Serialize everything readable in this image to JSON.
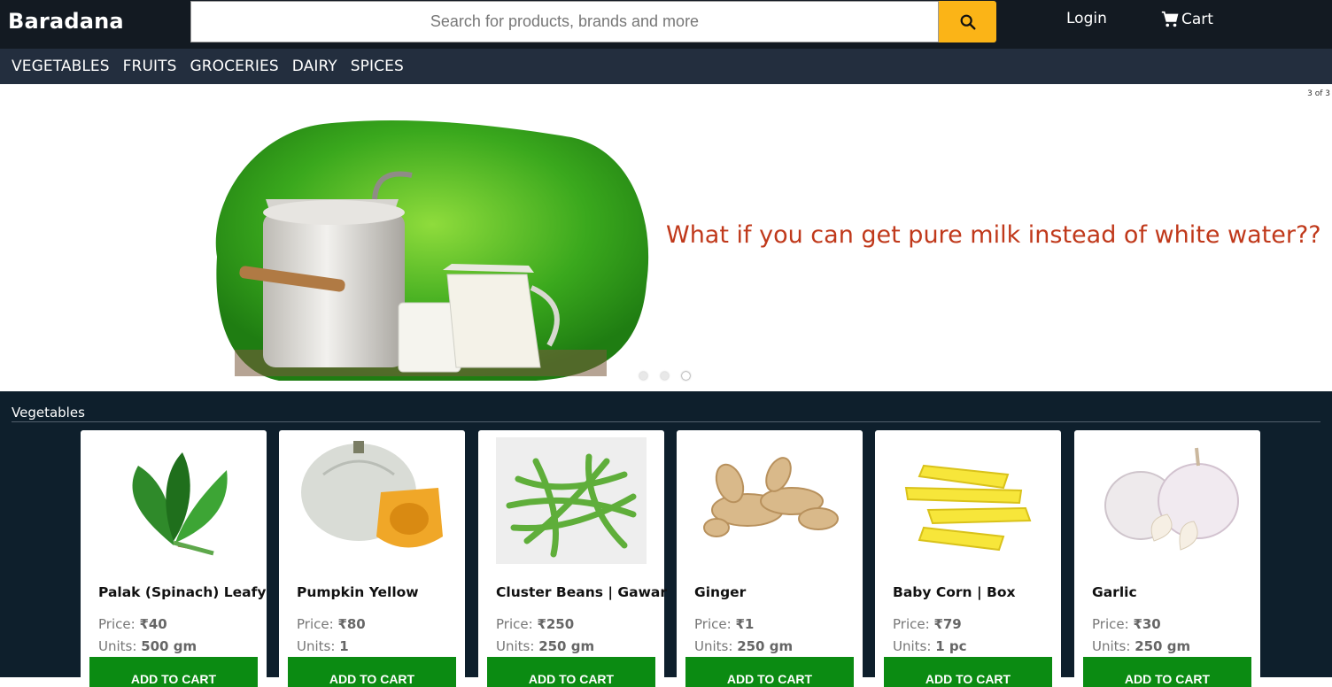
{
  "header": {
    "brand": "Baradana",
    "search_placeholder": "Search for products, brands and more",
    "search_icon": "search-icon",
    "login_label": "Login",
    "cart_label": "Cart",
    "cart_icon": "cart-icon",
    "accent": "#fbb417"
  },
  "categories": [
    "VEGETABLES",
    "FRUITS",
    "GROCERIES",
    "DAIRY",
    "SPICES"
  ],
  "banner": {
    "counter": "3 of 3",
    "headline": "What if you can get pure milk instead of white water??",
    "active_slide": 3,
    "slides": 3
  },
  "section": {
    "title": "Vegetables",
    "products": [
      {
        "name": "Palak (Spinach) Leafy",
        "price_label": "Price:",
        "price": "₹40",
        "units_label": "Units:",
        "units": "500 gm",
        "button": "ADD TO CART"
      },
      {
        "name": "Pumpkin Yellow",
        "price_label": "Price:",
        "price": "₹80",
        "units_label": "Units:",
        "units": "1",
        "button": "ADD TO CART"
      },
      {
        "name": "Cluster Beans | Gawar",
        "price_label": "Price:",
        "price": "₹250",
        "units_label": "Units:",
        "units": "250 gm",
        "button": "ADD TO CART"
      },
      {
        "name": "Ginger",
        "price_label": "Price:",
        "price": "₹1",
        "units_label": "Units:",
        "units": "250 gm",
        "button": "ADD TO CART"
      },
      {
        "name": "Baby Corn | Box",
        "price_label": "Price:",
        "price": "₹79",
        "units_label": "Units:",
        "units": "1 pc",
        "button": "ADD TO CART"
      },
      {
        "name": "Garlic",
        "price_label": "Price:",
        "price": "₹30",
        "units_label": "Units:",
        "units": "250 gm",
        "button": "ADD TO CART"
      }
    ]
  },
  "colors": {
    "topbar": "#131a22",
    "catnav": "#232e3e",
    "products_bg": "#0e1f2c",
    "headline": "#c0391b",
    "add_button": "#0b8b12"
  }
}
